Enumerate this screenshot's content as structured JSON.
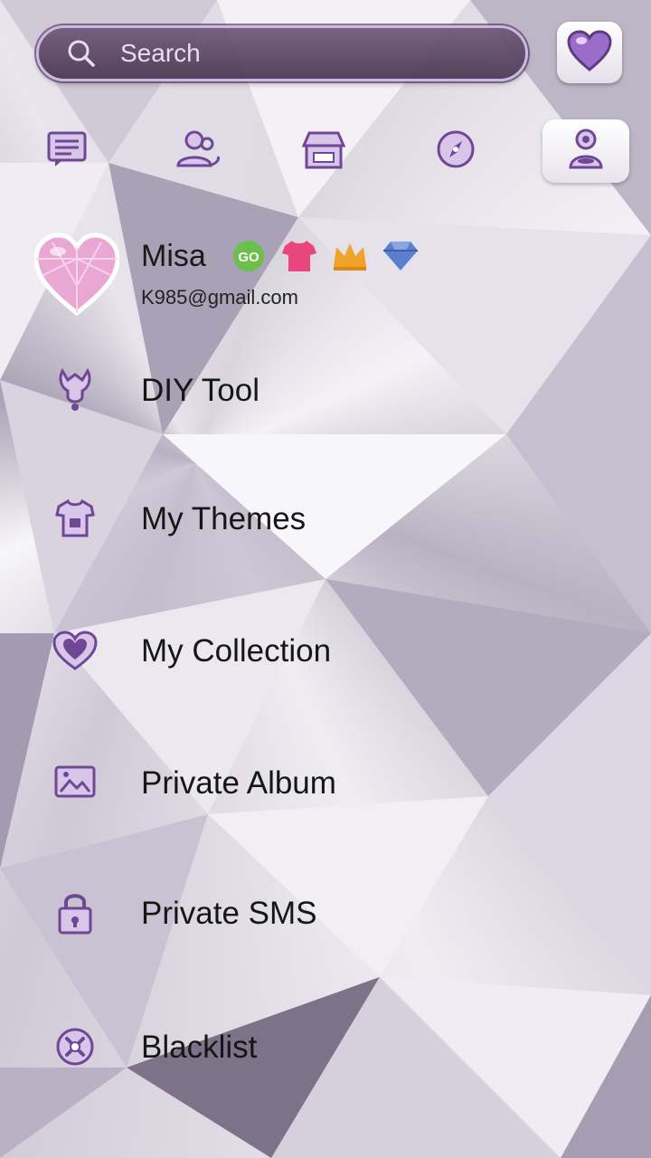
{
  "search": {
    "placeholder": "Search"
  },
  "tabs": [
    {
      "icon": "chat-icon"
    },
    {
      "icon": "contacts-icon"
    },
    {
      "icon": "store-icon"
    },
    {
      "icon": "compass-icon"
    },
    {
      "icon": "profile-icon",
      "active": true
    }
  ],
  "profile": {
    "name": "Misa",
    "email": "K985@gmail.com",
    "badges": [
      "go-badge-icon",
      "tshirt-badge-icon",
      "crown-badge-icon",
      "diamond-badge-icon"
    ]
  },
  "menu": [
    {
      "label": "DIY Tool",
      "icon": "diy-tool-icon"
    },
    {
      "label": "My Themes",
      "icon": "themes-icon"
    },
    {
      "label": "My Collection",
      "icon": "collection-heart-icon"
    },
    {
      "label": "Private Album",
      "icon": "album-icon"
    },
    {
      "label": "Private SMS",
      "icon": "lock-icon"
    },
    {
      "label": "Blacklist",
      "icon": "blacklist-icon"
    }
  ],
  "colors": {
    "accent": "#7b4fa0",
    "icon_purple": "#8c62b8",
    "search_bg": "#5a4566"
  }
}
